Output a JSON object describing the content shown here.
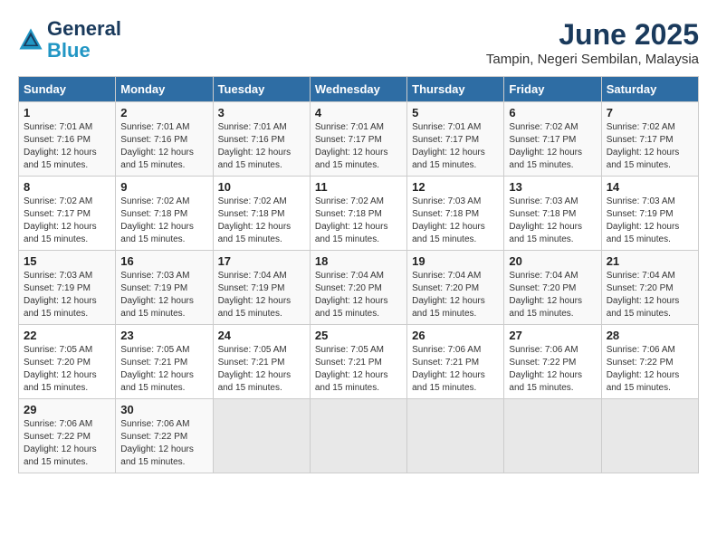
{
  "logo": {
    "line1": "General",
    "line2": "Blue"
  },
  "title": "June 2025",
  "subtitle": "Tampin, Negeri Sembilan, Malaysia",
  "days_of_week": [
    "Sunday",
    "Monday",
    "Tuesday",
    "Wednesday",
    "Thursday",
    "Friday",
    "Saturday"
  ],
  "weeks": [
    [
      {
        "day": "1",
        "sunrise": "7:01 AM",
        "sunset": "7:16 PM",
        "daylight": "12 hours and 15 minutes."
      },
      {
        "day": "2",
        "sunrise": "7:01 AM",
        "sunset": "7:16 PM",
        "daylight": "12 hours and 15 minutes."
      },
      {
        "day": "3",
        "sunrise": "7:01 AM",
        "sunset": "7:16 PM",
        "daylight": "12 hours and 15 minutes."
      },
      {
        "day": "4",
        "sunrise": "7:01 AM",
        "sunset": "7:17 PM",
        "daylight": "12 hours and 15 minutes."
      },
      {
        "day": "5",
        "sunrise": "7:01 AM",
        "sunset": "7:17 PM",
        "daylight": "12 hours and 15 minutes."
      },
      {
        "day": "6",
        "sunrise": "7:02 AM",
        "sunset": "7:17 PM",
        "daylight": "12 hours and 15 minutes."
      },
      {
        "day": "7",
        "sunrise": "7:02 AM",
        "sunset": "7:17 PM",
        "daylight": "12 hours and 15 minutes."
      }
    ],
    [
      {
        "day": "8",
        "sunrise": "7:02 AM",
        "sunset": "7:17 PM",
        "daylight": "12 hours and 15 minutes."
      },
      {
        "day": "9",
        "sunrise": "7:02 AM",
        "sunset": "7:18 PM",
        "daylight": "12 hours and 15 minutes."
      },
      {
        "day": "10",
        "sunrise": "7:02 AM",
        "sunset": "7:18 PM",
        "daylight": "12 hours and 15 minutes."
      },
      {
        "day": "11",
        "sunrise": "7:02 AM",
        "sunset": "7:18 PM",
        "daylight": "12 hours and 15 minutes."
      },
      {
        "day": "12",
        "sunrise": "7:03 AM",
        "sunset": "7:18 PM",
        "daylight": "12 hours and 15 minutes."
      },
      {
        "day": "13",
        "sunrise": "7:03 AM",
        "sunset": "7:18 PM",
        "daylight": "12 hours and 15 minutes."
      },
      {
        "day": "14",
        "sunrise": "7:03 AM",
        "sunset": "7:19 PM",
        "daylight": "12 hours and 15 minutes."
      }
    ],
    [
      {
        "day": "15",
        "sunrise": "7:03 AM",
        "sunset": "7:19 PM",
        "daylight": "12 hours and 15 minutes."
      },
      {
        "day": "16",
        "sunrise": "7:03 AM",
        "sunset": "7:19 PM",
        "daylight": "12 hours and 15 minutes."
      },
      {
        "day": "17",
        "sunrise": "7:04 AM",
        "sunset": "7:19 PM",
        "daylight": "12 hours and 15 minutes."
      },
      {
        "day": "18",
        "sunrise": "7:04 AM",
        "sunset": "7:20 PM",
        "daylight": "12 hours and 15 minutes."
      },
      {
        "day": "19",
        "sunrise": "7:04 AM",
        "sunset": "7:20 PM",
        "daylight": "12 hours and 15 minutes."
      },
      {
        "day": "20",
        "sunrise": "7:04 AM",
        "sunset": "7:20 PM",
        "daylight": "12 hours and 15 minutes."
      },
      {
        "day": "21",
        "sunrise": "7:04 AM",
        "sunset": "7:20 PM",
        "daylight": "12 hours and 15 minutes."
      }
    ],
    [
      {
        "day": "22",
        "sunrise": "7:05 AM",
        "sunset": "7:20 PM",
        "daylight": "12 hours and 15 minutes."
      },
      {
        "day": "23",
        "sunrise": "7:05 AM",
        "sunset": "7:21 PM",
        "daylight": "12 hours and 15 minutes."
      },
      {
        "day": "24",
        "sunrise": "7:05 AM",
        "sunset": "7:21 PM",
        "daylight": "12 hours and 15 minutes."
      },
      {
        "day": "25",
        "sunrise": "7:05 AM",
        "sunset": "7:21 PM",
        "daylight": "12 hours and 15 minutes."
      },
      {
        "day": "26",
        "sunrise": "7:06 AM",
        "sunset": "7:21 PM",
        "daylight": "12 hours and 15 minutes."
      },
      {
        "day": "27",
        "sunrise": "7:06 AM",
        "sunset": "7:22 PM",
        "daylight": "12 hours and 15 minutes."
      },
      {
        "day": "28",
        "sunrise": "7:06 AM",
        "sunset": "7:22 PM",
        "daylight": "12 hours and 15 minutes."
      }
    ],
    [
      {
        "day": "29",
        "sunrise": "7:06 AM",
        "sunset": "7:22 PM",
        "daylight": "12 hours and 15 minutes."
      },
      {
        "day": "30",
        "sunrise": "7:06 AM",
        "sunset": "7:22 PM",
        "daylight": "12 hours and 15 minutes."
      },
      null,
      null,
      null,
      null,
      null
    ]
  ]
}
